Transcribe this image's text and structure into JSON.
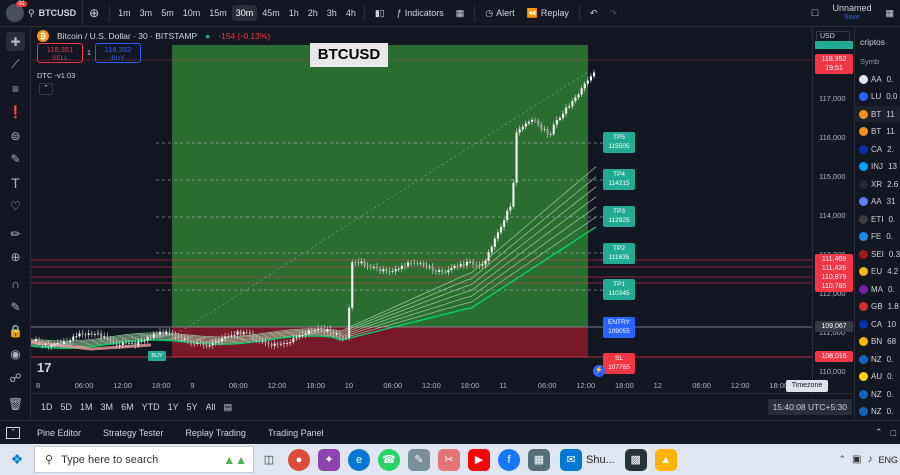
{
  "topbar": {
    "notif_count": "31",
    "symbol": "BTCUSD",
    "timeframes": [
      "1m",
      "3m",
      "5m",
      "10m",
      "15m",
      "30m",
      "45m",
      "1h",
      "2h",
      "3h",
      "4h"
    ],
    "active_timeframe": "30m",
    "indicators_label": "Indicators",
    "alert_label": "Alert",
    "replay_label": "Replay",
    "layout_name": "Unnamed",
    "layout_status": "Save"
  },
  "legend": {
    "title": "Bitcoin / U.S. Dollar · 30 · BITSTAMP",
    "change": "-154 (-0.13%)",
    "sell_price": "118,351",
    "sell_label": "SELL",
    "spread": "1",
    "buy_price": "118,352",
    "buy_label": "BUY",
    "indicator": "DTC -v1.03"
  },
  "overlay_title": "BTCUSD",
  "buy_marker": "BUY",
  "levels": {
    "tp5_label": "TP5",
    "tp5_value": "115505",
    "tp4_label": "TP4",
    "tp4_value": "114215",
    "tp3_label": "TP3",
    "tp3_value": "112925",
    "tp2_label": "TP2",
    "tp2_value": "111635",
    "tp1_label": "TP1",
    "tp1_value": "110345",
    "entry_label": "ENTRY",
    "entry_value": "109055",
    "sl_label": "SL",
    "sl_value": "107765"
  },
  "price_scale": {
    "currency": "USD",
    "ticks": [
      "117,000",
      "116,000",
      "115,000",
      "114,000",
      "113,000",
      "112,000",
      "111,000",
      "110,000"
    ],
    "last_price": "118,352",
    "countdown": "19:51",
    "labels": [
      "111,469",
      "111,426",
      "110,879",
      "110,785"
    ],
    "entry_price": "109,067",
    "sl_price": "108,016"
  },
  "time_axis": [
    "8",
    "06:00",
    "12:00",
    "18:00",
    "9",
    "06:00",
    "12:00",
    "18:00",
    "10",
    "06:00",
    "12:00",
    "18:00",
    "11",
    "06:00",
    "12:00",
    "18:00",
    "12",
    "06:00",
    "12:00",
    "18:00"
  ],
  "timezone_label": "Timezone",
  "clock": "15:40:08 UTC+5:30",
  "ranges": [
    "1D",
    "5D",
    "1M",
    "3M",
    "6M",
    "YTD",
    "1Y",
    "5Y",
    "All"
  ],
  "bottom_tabs": [
    "Pine Editor",
    "Strategy Tester",
    "Replay Trading",
    "Trading Panel"
  ],
  "watchlist": {
    "header": "criptos",
    "col": "Symb",
    "rows": [
      {
        "sym": "AA",
        "val": "0.",
        "color": "#e0e3eb"
      },
      {
        "sym": "LU",
        "val": "0.0",
        "color": "#2962ff"
      },
      {
        "sym": "BT",
        "val": "11",
        "color": "#f7931a"
      },
      {
        "sym": "BT",
        "val": "11",
        "color": "#f7931a"
      },
      {
        "sym": "CA",
        "val": "2.",
        "color": "#0033ad"
      },
      {
        "sym": "INJ",
        "val": "13",
        "color": "#00a3ff"
      },
      {
        "sym": "XR",
        "val": "2.6",
        "color": "#23292f"
      },
      {
        "sym": "AA",
        "val": "31",
        "color": "#627eea"
      },
      {
        "sym": "ETI",
        "val": "0.",
        "color": "#3c3c3d"
      },
      {
        "sym": "FE",
        "val": "0.",
        "color": "#1e88e5"
      },
      {
        "sym": "SEI",
        "val": "0.3",
        "color": "#9c1c1c"
      },
      {
        "sym": "EU",
        "val": "4.2",
        "color": "#f0b90b"
      },
      {
        "sym": "MA",
        "val": "0.",
        "color": "#7b1fa2"
      },
      {
        "sym": "GB",
        "val": "1.8",
        "color": "#d32f2f"
      },
      {
        "sym": "CA",
        "val": "10",
        "color": "#0033ad"
      },
      {
        "sym": "BN",
        "val": "68",
        "color": "#f0b90b"
      },
      {
        "sym": "NZ",
        "val": "0.",
        "color": "#1565c0"
      },
      {
        "sym": "AU",
        "val": "0.",
        "color": "#ffd600"
      },
      {
        "sym": "NZ",
        "val": "0.",
        "color": "#1565c0"
      },
      {
        "sym": "NZ",
        "val": "0.",
        "color": "#1565c0"
      }
    ]
  },
  "taskbar": {
    "search_placeholder": "Type here to search",
    "app_label": "Shu...",
    "lang": "ENG"
  },
  "colors": {
    "bg": "#131722",
    "tp": "#22ab94",
    "entry": "#2962ff",
    "sl": "#f23645",
    "zone_green": "#2e7d32",
    "zone_red": "#8b1a2a"
  }
}
